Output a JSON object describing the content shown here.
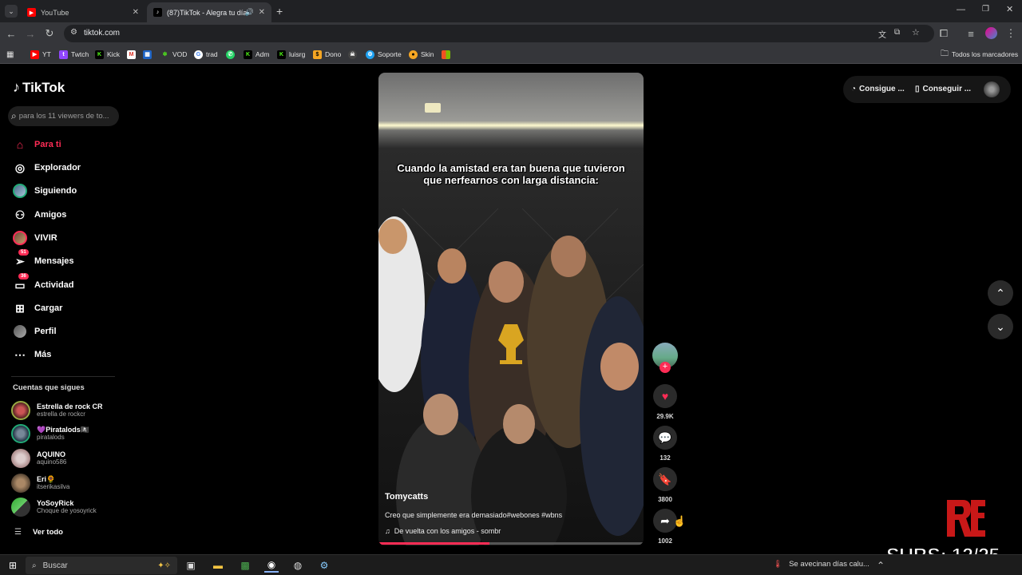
{
  "browser": {
    "tabs": [
      {
        "title": "YouTube",
        "active": false
      },
      {
        "title": "(87)TikTok - Alegra tu día",
        "active": true
      }
    ],
    "url": "tiktok.com",
    "bookmarks": [
      {
        "label": "YT",
        "color": "#ff0000"
      },
      {
        "label": "Twtch",
        "color": "#9146ff"
      },
      {
        "label": "Kick",
        "color": "#53fc18"
      },
      {
        "label": "VOD",
        "color": "#53fc18"
      },
      {
        "label": "trad",
        "color": "#4285f4"
      },
      {
        "label": "Adm",
        "color": "#53fc18"
      },
      {
        "label": "luisrg",
        "color": "#53fc18"
      },
      {
        "label": "Dono",
        "color": "#f5a623"
      },
      {
        "label": "Soporte",
        "color": "#1da1f2"
      },
      {
        "label": "Skin",
        "color": "#f5a623"
      }
    ],
    "all_bookmarks": "Todos los marcadores"
  },
  "sidebar": {
    "logo": "TikTok",
    "search_placeholder": "para los 11 viewers de to...",
    "nav": [
      {
        "label": "Para ti",
        "icon": "home-icon",
        "active": true
      },
      {
        "label": "Explorador",
        "icon": "compass-icon"
      },
      {
        "label": "Siguiendo",
        "icon": "avatar-icon"
      },
      {
        "label": "Amigos",
        "icon": "friends-icon"
      },
      {
        "label": "VIVIR",
        "icon": "live-icon"
      },
      {
        "label": "Mensajes",
        "icon": "message-icon",
        "badge": "51"
      },
      {
        "label": "Actividad",
        "icon": "activity-icon",
        "badge": "36"
      },
      {
        "label": "Cargar",
        "icon": "upload-icon"
      },
      {
        "label": "Perfil",
        "icon": "profile-icon"
      },
      {
        "label": "Más",
        "icon": "more-icon"
      }
    ],
    "following_title": "Cuentas que sigues",
    "accounts": [
      {
        "name": "Estrella de rock CR",
        "handle": "estrella de rockcr"
      },
      {
        "name": "💜Piratalods🏴‍☠️",
        "handle": "piratalods"
      },
      {
        "name": "AQUINO",
        "handle": "aquino586"
      },
      {
        "name": "Eri🌻",
        "handle": "itserikasilva"
      },
      {
        "name": "YoSoyRick",
        "handle": "Choque de yosoyrick"
      }
    ],
    "see_all": "Ver todo"
  },
  "video": {
    "overlay_text": "Cuando la amistad era tan buena que tuvieron que nerfearnos con larga distancia:",
    "author": "Tomycatts",
    "description": "Creo que simplemente era demasiado#webones #wbns",
    "music": "De vuelta con los amigos - sombr",
    "progress": 0.42
  },
  "actions": {
    "likes": "29.9K",
    "comments": "132",
    "saves": "3800",
    "shares": "1002"
  },
  "top_right": {
    "coins": "Consigue ...",
    "app": "Conseguir ..."
  },
  "overlay": {
    "subs": "SUBS: 12/25"
  },
  "taskbar": {
    "search": "Buscar",
    "weather": "Se avecinan días calu..."
  }
}
